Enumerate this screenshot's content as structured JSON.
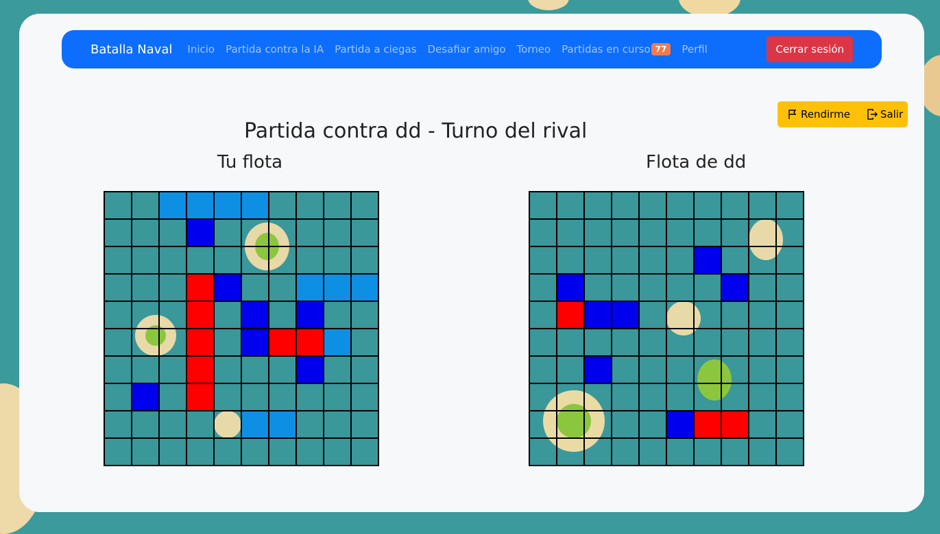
{
  "navbar": {
    "brand": "Batalla Naval",
    "links": [
      "Inicio",
      "Partida contra la IA",
      "Partida a ciegas",
      "Desafiar amigo",
      "Torneo",
      "Partidas en curso",
      "Perfil"
    ],
    "ongoing_badge": "77",
    "logout_label": "Cerrar sesión"
  },
  "actions": {
    "surrender_label": "Rendirme",
    "exit_label": "Salir"
  },
  "game": {
    "title": "Partida contra dd - Turno del rival",
    "own_board_title": "Tu flota",
    "enemy_board_title": "Flota de dd"
  },
  "colors": {
    "ship": "#0d8fe3",
    "hit": "#ff0000",
    "miss": "#0000ee",
    "water": "#3a979a",
    "navbar": "#0d6efd",
    "logout": "#dc3545",
    "actions": "#ffc107"
  },
  "legend_codes": {
    "W": "water",
    "S": "ship",
    "H": "hit",
    "M": "miss"
  },
  "own_board": [
    "WWSSSSWWWW",
    "WWWMWWWWWW",
    "WWWWWWWWWW",
    "WWWHMWWSSS",
    "WWWHWMWMWW",
    "WWWHWMHHSW",
    "WWWHWWWMWW",
    "WMWHWWWWWW",
    "WWWWWSSWWW",
    "WWWWWWWWWW"
  ],
  "enemy_board": [
    "WWWWWWWWWW",
    "WWWWWWWWWW",
    "WWWWWWMWWW",
    "WMWWWWWMWW",
    "WHMMWWWWWW",
    "WWWWWWWWWW",
    "WWMWWWWWWW",
    "WWWWWWWWWW",
    "WWWWWMHHWW",
    "WWWWWWWWWW"
  ]
}
